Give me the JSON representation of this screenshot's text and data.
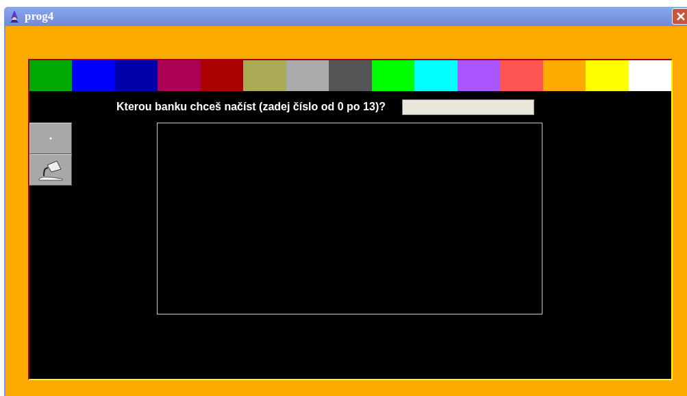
{
  "window": {
    "title": "prog4"
  },
  "palette": [
    {
      "color": "#00a800"
    },
    {
      "color": "#0000ff"
    },
    {
      "color": "#0000aa"
    },
    {
      "color": "#aa0055"
    },
    {
      "color": "#aa0000"
    },
    {
      "color": "#aaaa55"
    },
    {
      "color": "#aaaaaa"
    },
    {
      "color": "#555555"
    },
    {
      "color": "#00ff00"
    },
    {
      "color": "#00ffff"
    },
    {
      "color": "#aa55ff"
    },
    {
      "color": "#ff5555"
    },
    {
      "color": "#ffaa00"
    },
    {
      "color": "#ffff00"
    },
    {
      "color": "#ffffff"
    }
  ],
  "prompt": {
    "label": "Kterou banku chceš načíst (zadej číslo od 0 po 13)?"
  },
  "tools": [
    {
      "kind": "dot"
    },
    {
      "kind": "fill"
    }
  ]
}
